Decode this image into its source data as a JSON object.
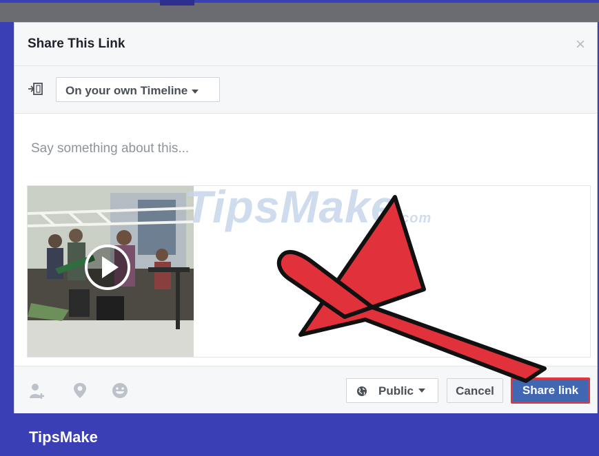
{
  "dialog": {
    "title": "Share This Link",
    "close_glyph": "×"
  },
  "target": {
    "selected": "On your own Timeline",
    "icon": "share-target-icon"
  },
  "composer": {
    "placeholder": "Say something about this..."
  },
  "preview": {
    "media": "video-thumbnail",
    "play_icon": "play-icon",
    "watermark": "TipsMake",
    "watermark_suffix": ".com"
  },
  "footer": {
    "icons": [
      "tag-friends-icon",
      "location-pin-icon",
      "feeling-smiley-icon"
    ],
    "audience_label": "Public",
    "cancel_label": "Cancel",
    "share_label": "Share link"
  },
  "brand": {
    "name": "TipsMake"
  },
  "colors": {
    "accent": "#4267b2",
    "highlight_border": "#e0343f",
    "arrow": "#e1313b",
    "frame": "#3b3fb6"
  }
}
